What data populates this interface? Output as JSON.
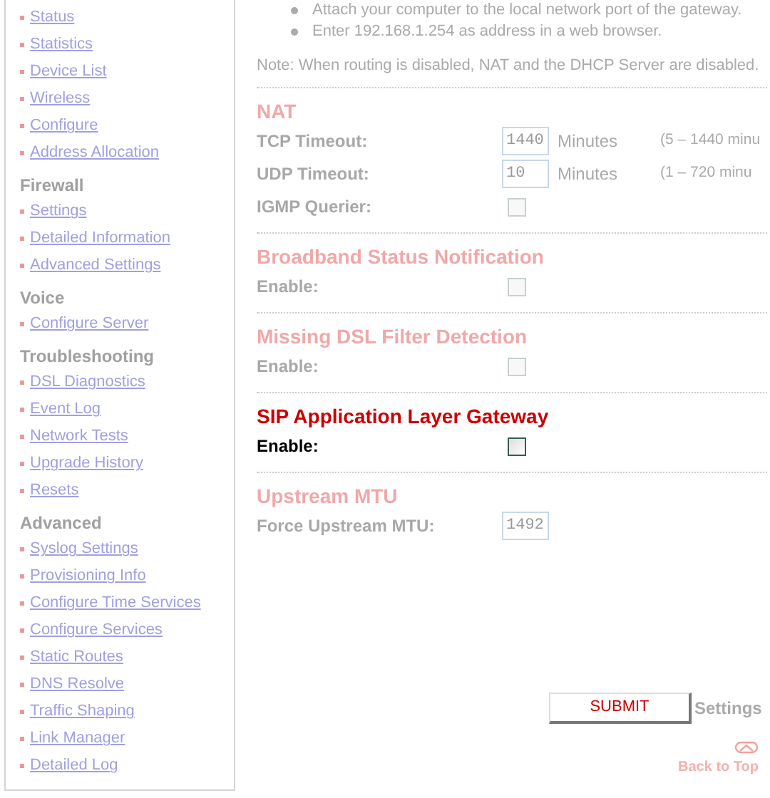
{
  "sidebar": {
    "groups": [
      {
        "items": [
          "Status",
          "Statistics",
          "Device List",
          "Wireless",
          "Configure",
          "Address Allocation"
        ]
      },
      {
        "heading": "Firewall",
        "items": [
          "Settings",
          "Detailed Information",
          "Advanced Settings"
        ]
      },
      {
        "heading": "Voice",
        "items": [
          "Configure Server"
        ]
      },
      {
        "heading": "Troubleshooting",
        "items": [
          "DSL Diagnostics",
          "Event Log",
          "Network Tests",
          "Upgrade History",
          "Resets"
        ]
      },
      {
        "heading": "Advanced",
        "items": [
          "Syslog Settings",
          "Provisioning Info",
          "Configure Time Services",
          "Configure Services",
          "Static Routes",
          "DNS Resolve",
          "Traffic Shaping",
          "Link Manager",
          "Detailed Log"
        ]
      }
    ]
  },
  "instructions": [
    "Attach your computer to the local network port of the gateway.",
    "Enter 192.168.1.254 as address in a web browser."
  ],
  "note": "Note: When routing is disabled, NAT and the DHCP Server are disabled.",
  "sections": [
    {
      "title": "NAT",
      "disabled": true,
      "fields": [
        {
          "kind": "text",
          "label": "TCP Timeout:",
          "value": "1440",
          "unit": "Minutes",
          "range": "(5 – 1440 minu"
        },
        {
          "kind": "text",
          "label": "UDP Timeout:",
          "value": "10",
          "unit": "Minutes",
          "range": "(1 – 720 minu"
        },
        {
          "kind": "checkbox",
          "label": "IGMP Querier:",
          "checked": false
        }
      ]
    },
    {
      "title": "Broadband Status Notification",
      "disabled": true,
      "fields": [
        {
          "kind": "checkbox",
          "label": "Enable:",
          "checked": false
        }
      ]
    },
    {
      "title": "Missing DSL Filter Detection",
      "disabled": true,
      "fields": [
        {
          "kind": "checkbox",
          "label": "Enable:",
          "checked": false
        }
      ]
    },
    {
      "title": "SIP Application Layer Gateway",
      "disabled": false,
      "fields": [
        {
          "kind": "checkbox",
          "label": "Enable:",
          "checked": false
        }
      ]
    },
    {
      "title": "Upstream MTU",
      "disabled": true,
      "fields": [
        {
          "kind": "text",
          "label": "Force Upstream MTU:",
          "value": "1492"
        }
      ]
    }
  ],
  "submit": "SUBMIT",
  "submit_caption": "Settings",
  "back_to_top": "Back to Top"
}
